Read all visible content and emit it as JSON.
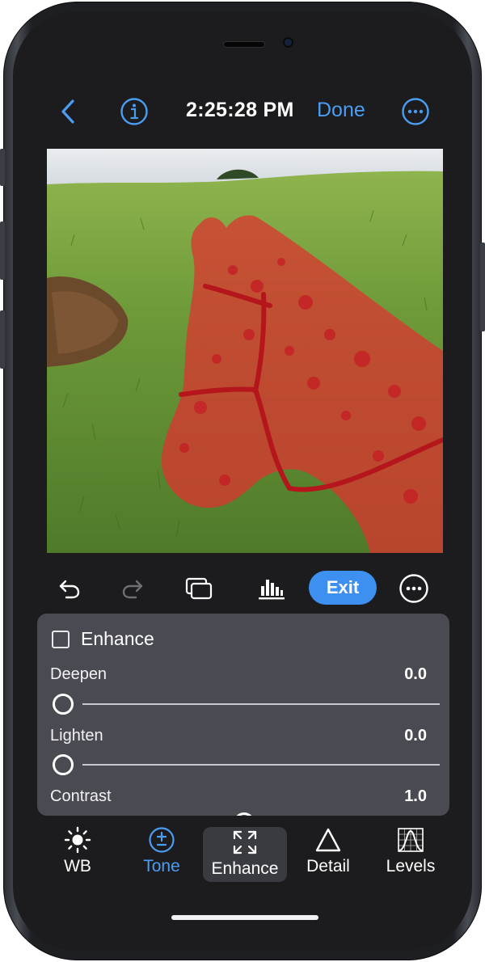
{
  "status": {
    "time": "2:25:28 PM"
  },
  "topbar": {
    "back_icon": "chevron-left-icon",
    "info_icon": "info-circle-icon",
    "done_label": "Done",
    "more_icon": "ellipsis-circle-icon",
    "accent_color": "#4a9df2"
  },
  "photo": {
    "subject_icon": "horse-photo",
    "mask_overlay_color": "#e0302f"
  },
  "toolbar": {
    "undo_icon": "undo-icon",
    "redo_icon": "redo-icon",
    "compare_icon": "compare-icon",
    "histogram_icon": "histogram-icon",
    "exit_label": "Exit",
    "more_icon": "ellipsis-circle-icon",
    "exit_color": "#3d8ff0"
  },
  "panel": {
    "enhance_label": "Enhance",
    "enhance_checked": false,
    "sliders": [
      {
        "label": "Deepen",
        "value": "0.0",
        "position": 0.0
      },
      {
        "label": "Lighten",
        "value": "0.0",
        "position": 0.0
      },
      {
        "label": "Contrast",
        "value": "1.0",
        "position": 0.5
      }
    ]
  },
  "tabs": [
    {
      "label": "WB",
      "icon": "sun-icon",
      "state": "normal"
    },
    {
      "label": "Tone",
      "icon": "plus-minus-circle-icon",
      "state": "highlighted"
    },
    {
      "label": "Enhance",
      "icon": "expand-arrows-icon",
      "state": "selected"
    },
    {
      "label": "Detail",
      "icon": "triangle-icon",
      "state": "normal"
    },
    {
      "label": "Levels",
      "icon": "bell-curve-icon",
      "state": "normal"
    }
  ]
}
